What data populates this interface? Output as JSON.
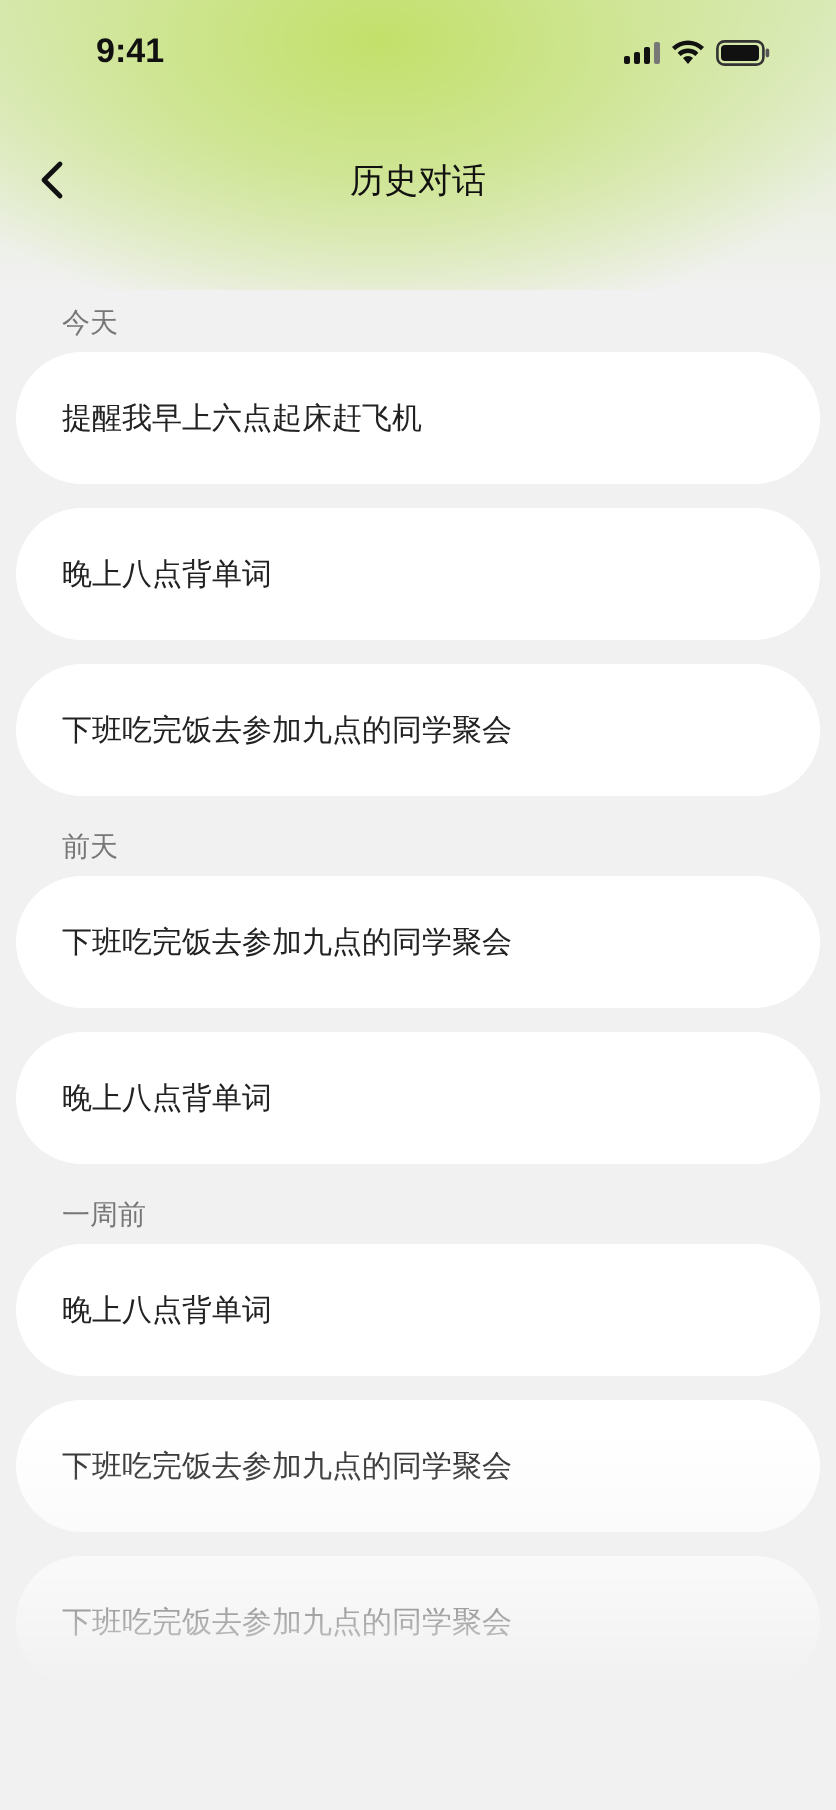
{
  "status_bar": {
    "time": "9:41"
  },
  "nav": {
    "title": "历史对话"
  },
  "sections": [
    {
      "label": "今天",
      "items": [
        "提醒我早上六点起床赶飞机",
        "晚上八点背单词",
        "下班吃完饭去参加九点的同学聚会"
      ]
    },
    {
      "label": "前天",
      "items": [
        "下班吃完饭去参加九点的同学聚会",
        "晚上八点背单词"
      ]
    },
    {
      "label": "一周前",
      "items": [
        "晚上八点背单词",
        "下班吃完饭去参加九点的同学聚会",
        "下班吃完饭去参加九点的同学聚会"
      ]
    }
  ]
}
